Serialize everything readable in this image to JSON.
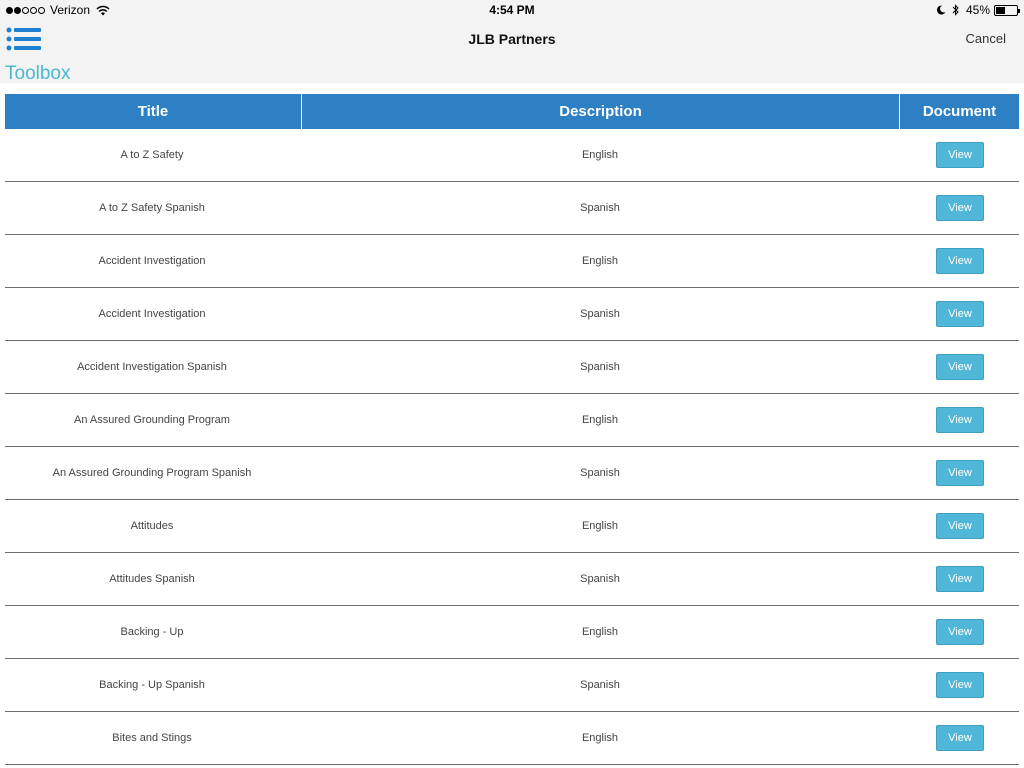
{
  "status_bar": {
    "carrier": "Verizon",
    "time": "4:54 PM",
    "battery_percent": "45%",
    "battery_level": 0.45,
    "signal_strength": 2,
    "signal_max": 5
  },
  "nav": {
    "title": "JLB Partners",
    "cancel_label": "Cancel",
    "menu_icon": "list-menu-icon"
  },
  "section": {
    "title": "Toolbox"
  },
  "colors": {
    "header_blue": "#2d80c4",
    "accent_teal": "#4bb8cc",
    "button_blue": "#50b7d9"
  },
  "table": {
    "headers": [
      "Title",
      "Description",
      "Document"
    ],
    "rows": [
      {
        "title": "A to Z Safety",
        "description": "English",
        "document": "View"
      },
      {
        "title": "A to Z Safety Spanish",
        "description": "Spanish",
        "document": "View"
      },
      {
        "title": "Accident Investigation",
        "description": "English",
        "document": "View"
      },
      {
        "title": "Accident Investigation",
        "description": "Spanish",
        "document": "View"
      },
      {
        "title": "Accident Investigation Spanish",
        "description": "Spanish",
        "document": "View"
      },
      {
        "title": "An Assured Grounding Program",
        "description": "English",
        "document": "View"
      },
      {
        "title": "An Assured Grounding Program Spanish",
        "description": "Spanish",
        "document": "View"
      },
      {
        "title": "Attitudes",
        "description": "English",
        "document": "View"
      },
      {
        "title": "Attitudes Spanish",
        "description": "Spanish",
        "document": "View"
      },
      {
        "title": "Backing - Up",
        "description": "English",
        "document": "View"
      },
      {
        "title": "Backing - Up Spanish",
        "description": "Spanish",
        "document": "View"
      },
      {
        "title": "Bites and Stings",
        "description": "English",
        "document": "View"
      }
    ]
  }
}
